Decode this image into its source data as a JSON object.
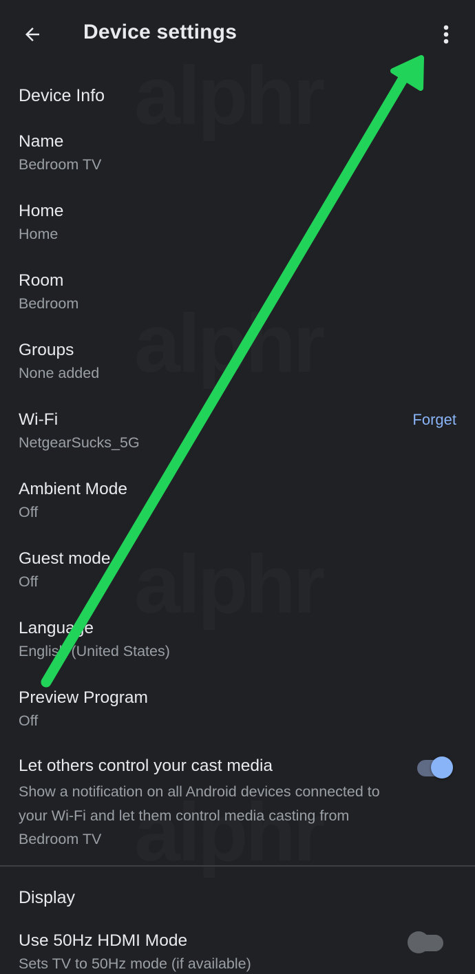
{
  "appbar": {
    "title": "Device settings",
    "back_icon": "arrow-back-icon",
    "more_icon": "more-vert-icon"
  },
  "watermark": "alphr",
  "device_info": {
    "header": "Device Info",
    "rows": [
      {
        "title": "Name",
        "value": "Bedroom TV"
      },
      {
        "title": "Home",
        "value": "Home"
      },
      {
        "title": "Room",
        "value": "Bedroom"
      },
      {
        "title": "Groups",
        "value": "None added"
      },
      {
        "title": "Wi-Fi",
        "value": "NetgearSucks_5G",
        "action": "Forget"
      },
      {
        "title": "Ambient Mode",
        "value": "Off"
      },
      {
        "title": "Guest mode",
        "value": "Off"
      },
      {
        "title": "Language",
        "value": "English (United States)"
      },
      {
        "title": "Preview Program",
        "value": "Off"
      }
    ],
    "cast_control": {
      "title": "Let others control your cast media",
      "description": "Show a notification on all Android devices connected to your Wi-Fi and let them control media casting from Bedroom TV",
      "enabled": true
    }
  },
  "display": {
    "header": "Display",
    "hdmi_50hz": {
      "title": "Use 50Hz HDMI Mode",
      "description": "Sets TV to 50Hz mode (if available)",
      "enabled": false
    }
  },
  "colors": {
    "background": "#202124",
    "primary_text": "#e8eaed",
    "secondary_text": "#9aa0a6",
    "accent": "#8ab4f8",
    "annotation_arrow": "#22d35a"
  }
}
